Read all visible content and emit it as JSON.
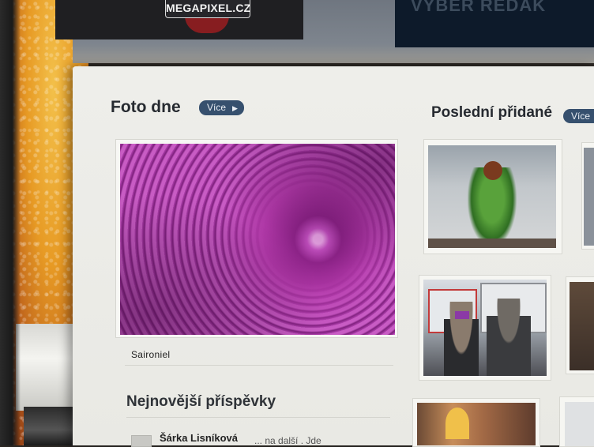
{
  "header": {
    "logo_text": "MEGAPIXEL.CZ",
    "banner_right_text": "VÝBĚR REDAK"
  },
  "foto_dne": {
    "title": "Foto dne",
    "more_label": "Více",
    "author": "Saironiel"
  },
  "posledni": {
    "title": "Poslední přidané",
    "more_label": "Více"
  },
  "nejnovejsi": {
    "title": "Nejnovější příspěvky",
    "posts": [
      {
        "author": "Šárka Lisníková",
        "snippet": "... na další . Jde"
      }
    ]
  },
  "colors": {
    "accent_button": "#36506e",
    "page_background": "#eeeeea",
    "banner_dark": "#1f1f22"
  }
}
